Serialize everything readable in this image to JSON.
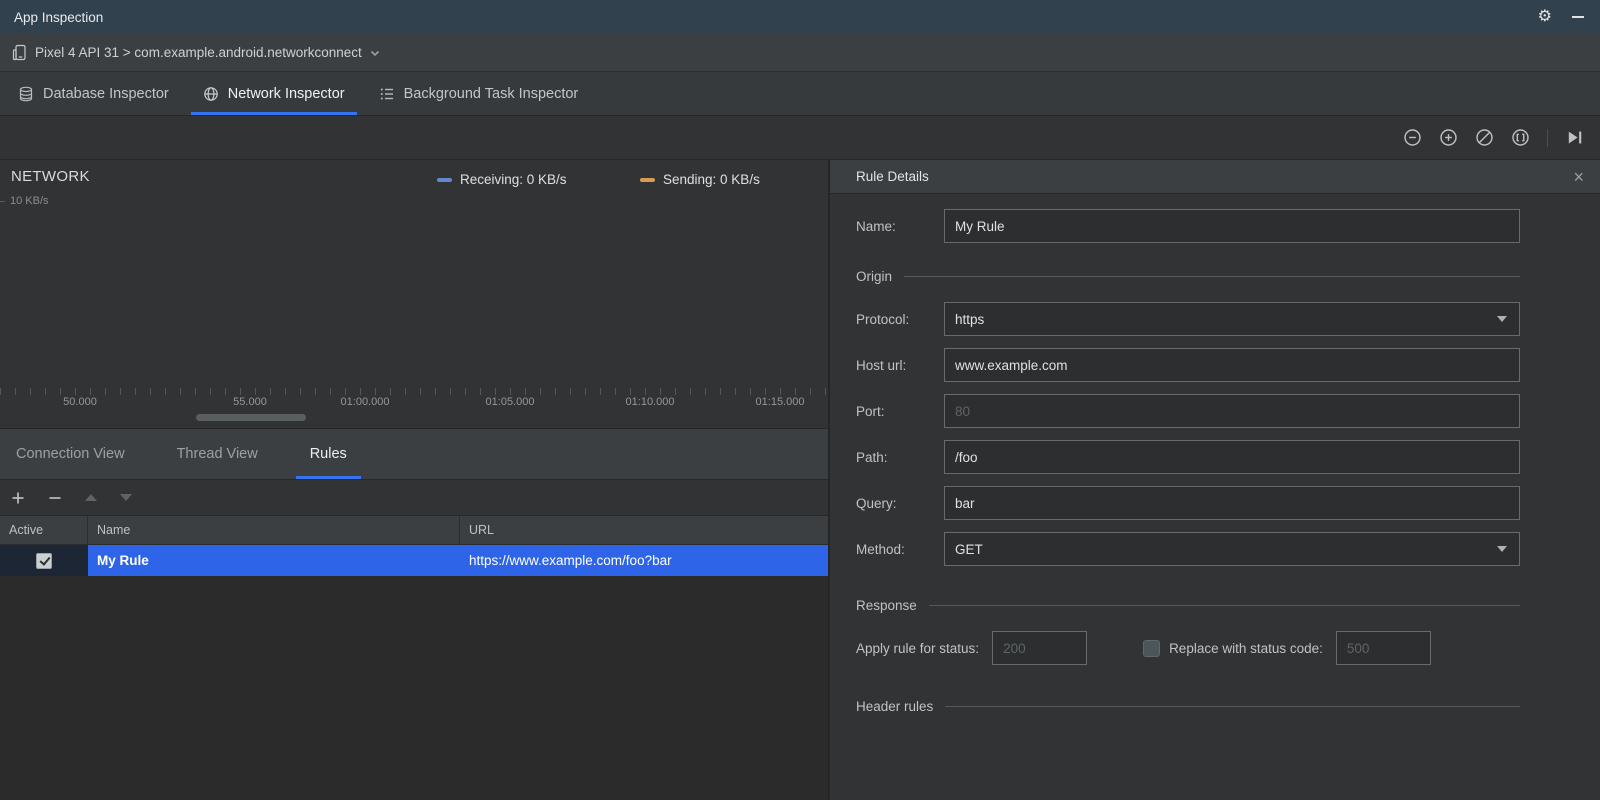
{
  "titlebar": {
    "title": "App Inspection"
  },
  "device_bar": {
    "selector": "Pixel 4 API 31 > com.example.android.networkconnect"
  },
  "inspector_tabs": {
    "items": [
      {
        "label": "Database Inspector",
        "active": false
      },
      {
        "label": "Network Inspector",
        "active": true
      },
      {
        "label": "Background Task Inspector",
        "active": false
      }
    ]
  },
  "chart": {
    "title": "NETWORK",
    "y_axis_label": "10 KB/s",
    "legend": {
      "receiving": "Receiving: 0 KB/s",
      "sending": "Sending: 0 KB/s"
    },
    "x_ticks": [
      "50.000",
      "55.000",
      "01:00.000",
      "01:05.000",
      "01:10.000",
      "01:15.000"
    ]
  },
  "view_tabs": {
    "connection": "Connection View",
    "thread": "Thread View",
    "rules": "Rules",
    "active": "Rules"
  },
  "rules_table": {
    "columns": {
      "active": "Active",
      "name": "Name",
      "url": "URL"
    },
    "row": {
      "active": true,
      "name": "My Rule",
      "url": "https://www.example.com/foo?bar",
      "selected": true
    }
  },
  "rule_details": {
    "title": "Rule Details",
    "name_label": "Name:",
    "name_value": "My Rule",
    "origin_section": "Origin",
    "protocol_label": "Protocol:",
    "protocol_value": "https",
    "host_label": "Host url:",
    "host_value": "www.example.com",
    "port_label": "Port:",
    "port_placeholder": "80",
    "path_label": "Path:",
    "path_value": "/foo",
    "query_label": "Query:",
    "query_value": "bar",
    "method_label": "Method:",
    "method_value": "GET",
    "response_section": "Response",
    "apply_status_label": "Apply rule for status:",
    "apply_status_placeholder": "200",
    "replace_status_label": "Replace with status code:",
    "replace_status_placeholder": "500",
    "replace_checkbox_checked": false,
    "header_rules_section": "Header rules"
  },
  "icons": {
    "settings": "gear",
    "minimize": "horizontal-dash",
    "device": "phone-outline",
    "device_dropdown": "chevron-down",
    "database_inspector": "database-cylinder",
    "network_inspector": "globe",
    "background_task_inspector": "task-list",
    "zoom_out": "circle-minus",
    "zoom_in": "circle-plus",
    "reset_zoom": "circle-slash",
    "zoom_to_selection": "circle-brackets",
    "go_live": "play-to-bar",
    "add_rule": "plus",
    "remove_rule": "minus",
    "move_up": "triangle-up",
    "move_down": "triangle-down",
    "close_panel": "x"
  },
  "colors": {
    "accent": "#3574f0",
    "selection": "#2e65e8",
    "receiving": "#6586c8",
    "sending": "#d89b51"
  }
}
